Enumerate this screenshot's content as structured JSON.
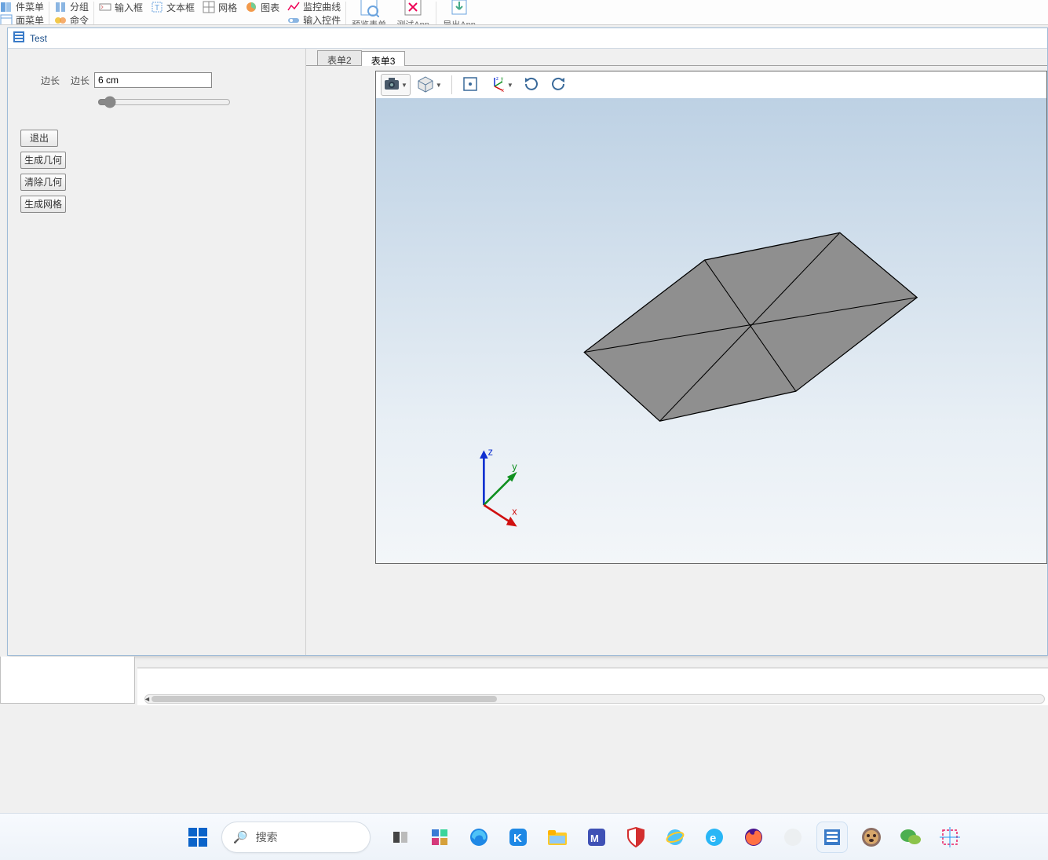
{
  "ribbon": {
    "left_top": "件菜单",
    "left_bot": "面菜单",
    "group_label": "分组",
    "merge_label": "命令",
    "input_box": "输入框",
    "text_box": "文本框",
    "grid": "网格",
    "chart": "图表",
    "monitor": "监控曲线",
    "input_ctrl": "输入控件",
    "preview": "预览表单",
    "test_app": "测试App",
    "export_app": "导出App"
  },
  "window": {
    "title": "Test"
  },
  "params": {
    "label_outer": "边长",
    "label_inner": "边长",
    "value": "6 cm",
    "slider": 5
  },
  "buttons": {
    "exit": "退出",
    "gen_geom": "生成几何",
    "clear_geom": "清除几何",
    "gen_mesh": "生成网格"
  },
  "tabs": {
    "t2": "表单2",
    "t3": "表单3"
  },
  "axes": {
    "x": "x",
    "y": "y",
    "z": "z"
  },
  "taskbar": {
    "search": "搜索"
  }
}
